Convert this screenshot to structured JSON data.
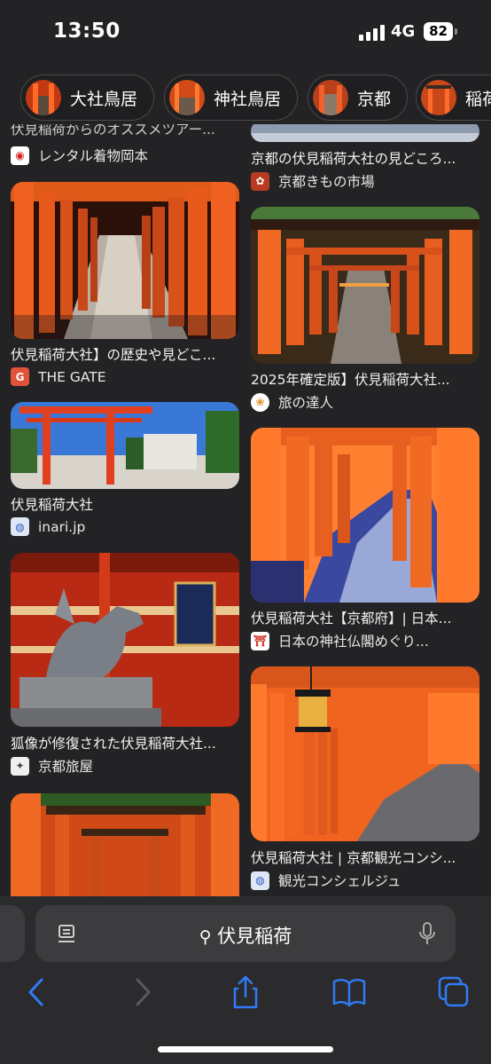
{
  "status": {
    "time": "13:50",
    "network": "4G",
    "battery": "82"
  },
  "chips": [
    {
      "label": "大社鳥居"
    },
    {
      "label": "神社鳥居"
    },
    {
      "label": "京都"
    },
    {
      "label": "稲荷"
    }
  ],
  "results": {
    "left": [
      {
        "caption": "伏見稲荷からのオススメツアー...",
        "source": "レンタル着物岡本"
      },
      {
        "caption": "伏見稲荷大社】の歴史や見どこ...",
        "source": "THE GATE"
      },
      {
        "caption": "伏見稲荷大社",
        "source": "inari.jp"
      },
      {
        "caption": "狐像が修復された伏見稲荷大社...",
        "source": "京都旅屋"
      }
    ],
    "right": [
      {
        "caption": "京都の伏見稲荷大社の見どころ...",
        "source": "京都きもの市場"
      },
      {
        "caption": "2025年確定版】伏見稲荷大社...",
        "source": "旅の達人"
      },
      {
        "caption": "伏見稲荷大社【京都府】| 日本...",
        "source": "日本の神社仏閣めぐり..."
      },
      {
        "caption": "伏見稲荷大社 | 京都観光コンシ...",
        "source": "観光コンシェルジュ"
      }
    ]
  },
  "search": {
    "query": "伏見稲荷"
  },
  "colors": {
    "background": "#232325",
    "accent": "#2f7bf6",
    "torii": "#e8501a"
  }
}
